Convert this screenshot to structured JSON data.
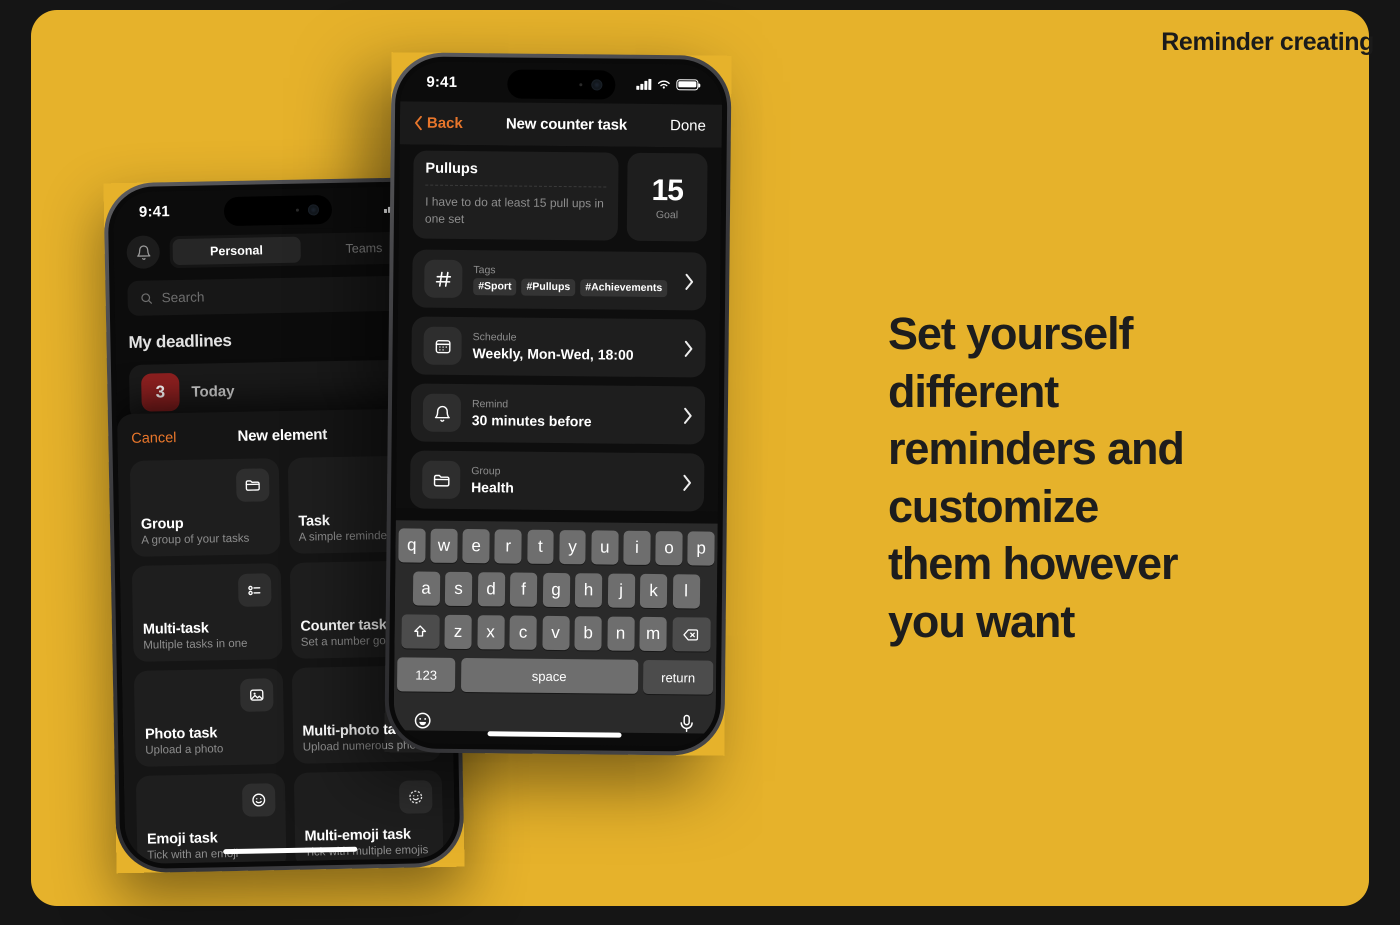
{
  "slide": {
    "title": "Reminder creating",
    "background_color": "#E6B22B",
    "outer_color": "#151515",
    "accent_color": "#E8762B",
    "headline_lines": [
      "Set yourself",
      "different",
      "reminders and",
      "customize",
      "them however",
      "you want"
    ]
  },
  "front_phone": {
    "status_bar": {
      "time": "9:41",
      "signal_icon": "signal-bars-icon",
      "wifi_icon": "wifi-icon",
      "battery_icon": "battery-icon"
    },
    "nav": {
      "back_label": "Back",
      "title": "New counter task",
      "done_label": "Done"
    },
    "task": {
      "title": "Pullups",
      "description": "I have to do at least 15 pull ups in one set",
      "goal_value": "15",
      "goal_label": "Goal"
    },
    "rows": [
      {
        "icon": "hash-icon",
        "label": "Tags",
        "value": "",
        "chips": [
          "#Sport",
          "#Pullups",
          "#Achievements"
        ]
      },
      {
        "icon": "calendar-icon",
        "label": "Schedule",
        "value": "Weekly, Mon-Wed, 18:00",
        "chips": []
      },
      {
        "icon": "bell-icon",
        "label": "Remind",
        "value": "30 minutes before",
        "chips": []
      },
      {
        "icon": "folder-icon",
        "label": "Group",
        "value": "Health",
        "chips": []
      }
    ],
    "keyboard": {
      "row1": [
        "q",
        "w",
        "e",
        "r",
        "t",
        "y",
        "u",
        "i",
        "o",
        "p"
      ],
      "row2": [
        "a",
        "s",
        "d",
        "f",
        "g",
        "h",
        "j",
        "k",
        "l"
      ],
      "row3": [
        "z",
        "x",
        "c",
        "v",
        "b",
        "n",
        "m"
      ],
      "shift_icon": "shift-icon",
      "backspace_icon": "backspace-icon",
      "numbers_label": "123",
      "space_label": "space",
      "return_label": "return",
      "emoji_icon": "emoji-icon",
      "mic_icon": "microphone-icon"
    }
  },
  "back_phone": {
    "status_bar": {
      "time": "9:41",
      "signal_icon": "signal-bars-icon",
      "wifi_icon": "wifi-icon"
    },
    "bell_icon": "bell-icon",
    "tabs": [
      {
        "label": "Personal",
        "active": true
      },
      {
        "label": "Teams",
        "active": false
      }
    ],
    "search_placeholder": "Search",
    "search_icon": "search-icon",
    "section_title": "My deadlines",
    "deadline": {
      "count": "3",
      "label": "Today",
      "badge_color": "#8F2020"
    },
    "sheet": {
      "cancel_label": "Cancel",
      "title": "New element",
      "cards": [
        {
          "icon": "folder-icon",
          "title": "Group",
          "subtitle": "A group of your tasks"
        },
        {
          "icon": "checkmark-icon",
          "title": "Task",
          "subtitle": "A simple reminder"
        },
        {
          "icon": "list-icon",
          "title": "Multi-task",
          "subtitle": "Multiple tasks in one"
        },
        {
          "icon": "counter-icon",
          "title": "Counter task",
          "subtitle": "Set a number goal"
        },
        {
          "icon": "photo-icon",
          "title": "Photo task",
          "subtitle": "Upload a photo"
        },
        {
          "icon": "multi-photo-icon",
          "title": "Multi-photo task",
          "subtitle": "Upload numerous photos"
        },
        {
          "icon": "emoji-icon",
          "title": "Emoji task",
          "subtitle": "Tick with an emoji"
        },
        {
          "icon": "multi-emoji-icon",
          "title": "Multi-emoji task",
          "subtitle": "Tick with multiple emojis"
        }
      ]
    }
  }
}
